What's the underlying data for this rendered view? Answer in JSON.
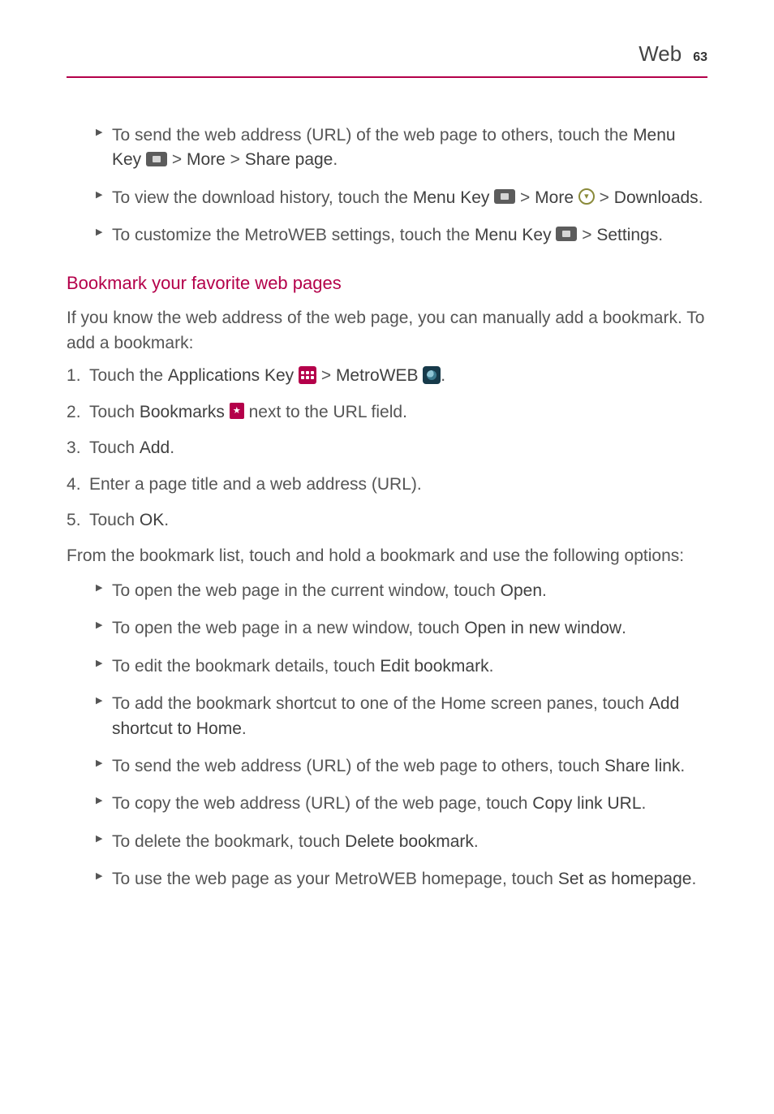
{
  "header": {
    "title": "Web",
    "page": "63"
  },
  "intro_bullets": [
    {
      "pre": "To send the web address (URL) of the web page to others, touch the ",
      "bold1": "Menu Key ",
      "icon1": "menu-key",
      "mid1": " > ",
      "bold2": "More",
      "mid2": " > ",
      "bold3": "Share page",
      "post": "."
    },
    {
      "pre": "To view the download history, touch the ",
      "bold1": "Menu Key ",
      "icon1": "menu-key",
      "mid1": " > ",
      "bold2": "More ",
      "icon2": "more-circle",
      "mid2": " > ",
      "bold3": "Downloads",
      "post": "."
    },
    {
      "pre": "To customize the MetroWEB settings, touch the ",
      "bold1": "Menu Key ",
      "icon1": "menu-key",
      "mid1": " > ",
      "bold3": "Settings",
      "post": "."
    }
  ],
  "section_title": "Bookmark your favorite web pages",
  "section_intro": "If you know the web address of the web page, you can manually add a bookmark. To add a bookmark:",
  "steps": [
    {
      "pre": "Touch the ",
      "bold1": "Applications Key ",
      "icon1": "apps-key",
      "mid1": " > ",
      "bold2": "MetroWEB ",
      "icon2": "metroweb",
      "post": "."
    },
    {
      "pre": "Touch ",
      "bold1": "Bookmarks ",
      "icon1": "bookmark",
      "post": " next to the URL field."
    },
    {
      "pre": "Touch ",
      "bold1": "Add",
      "post": "."
    },
    {
      "pre": "Enter a page title and a web address (URL)."
    },
    {
      "pre": "Touch ",
      "bold1": "OK",
      "post": "."
    }
  ],
  "options_intro": "From the bookmark list, touch and hold a bookmark and use the following options:",
  "option_bullets": [
    {
      "pre": "To open the web page in the current window, touch ",
      "bold1": "Open",
      "post": "."
    },
    {
      "pre": "To open the web page in a new window, touch ",
      "bold1": "Open in new window",
      "post": "."
    },
    {
      "pre": "To edit the bookmark details, touch ",
      "bold1": "Edit bookmark",
      "post": "."
    },
    {
      "pre": "To add the bookmark shortcut to one of the Home screen panes, touch ",
      "bold1": "Add shortcut to Home",
      "post": "."
    },
    {
      "pre": "To send the web address (URL) of the web page to others, touch ",
      "bold1": "Share link",
      "post": "."
    },
    {
      "pre": "To copy the web address (URL) of the web page, touch ",
      "bold1": "Copy link URL",
      "post": "."
    },
    {
      "pre": "To delete the bookmark, touch ",
      "bold1": "Delete bookmark",
      "post": "."
    },
    {
      "pre": "To use the web page as your MetroWEB homepage, touch ",
      "bold1": "Set as homepage",
      "post": "."
    }
  ]
}
